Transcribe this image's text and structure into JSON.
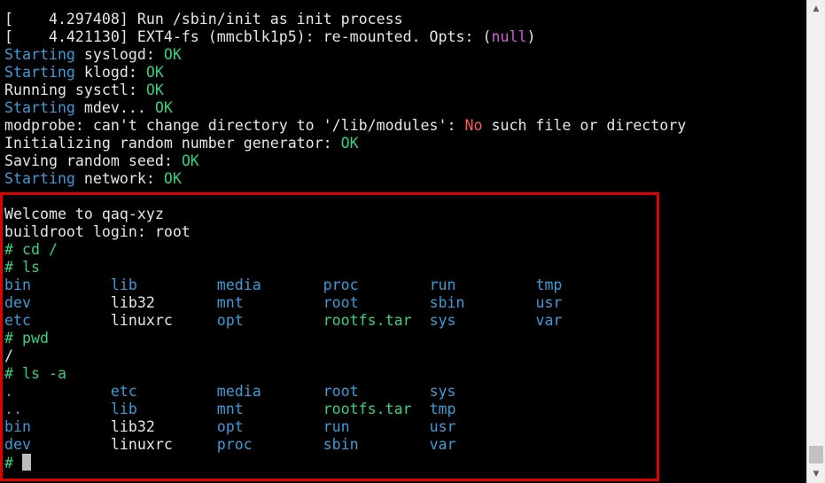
{
  "terminal": {
    "colors": {
      "white": "#e6e6e6",
      "cyan": "#3a9bd8",
      "green": "#35d07f",
      "red": "#ff5a5a",
      "magenta": "#d05ad8",
      "highlight_border": "#e00000"
    },
    "lines": [
      [
        {
          "t": "[    4.297408] Run /sbin/init as init process",
          "c": "white"
        }
      ],
      [
        {
          "t": "[    4.421130] EXT4-fs (mmcblk1p5): re-mounted. Opts: (",
          "c": "white"
        },
        {
          "t": "null",
          "c": "magenta"
        },
        {
          "t": ")",
          "c": "white"
        }
      ],
      [
        {
          "t": "Starting",
          "c": "cyan"
        },
        {
          "t": " syslogd: ",
          "c": "white"
        },
        {
          "t": "OK",
          "c": "green"
        }
      ],
      [
        {
          "t": "Starting",
          "c": "cyan"
        },
        {
          "t": " klogd: ",
          "c": "white"
        },
        {
          "t": "OK",
          "c": "green"
        }
      ],
      [
        {
          "t": "Running sysctl: ",
          "c": "white"
        },
        {
          "t": "OK",
          "c": "green"
        }
      ],
      [
        {
          "t": "Starting",
          "c": "cyan"
        },
        {
          "t": " mdev... ",
          "c": "white"
        },
        {
          "t": "OK",
          "c": "green"
        }
      ],
      [
        {
          "t": "modprobe: can't change directory to '/lib/modules': ",
          "c": "white"
        },
        {
          "t": "No",
          "c": "red"
        },
        {
          "t": " such file or directory",
          "c": "white"
        }
      ],
      [
        {
          "t": "Initializing random number generator: ",
          "c": "white"
        },
        {
          "t": "OK",
          "c": "green"
        }
      ],
      [
        {
          "t": "Saving random seed: ",
          "c": "white"
        },
        {
          "t": "OK",
          "c": "green"
        }
      ],
      [
        {
          "t": "Starting",
          "c": "cyan"
        },
        {
          "t": " network: ",
          "c": "white"
        },
        {
          "t": "OK",
          "c": "green"
        }
      ],
      [
        {
          "t": "",
          "c": "white"
        }
      ],
      [
        {
          "t": "Welcome to qaq-xyz",
          "c": "white"
        }
      ],
      [
        {
          "t": "buildroot login: root",
          "c": "white"
        }
      ],
      [
        {
          "t": "# cd /",
          "c": "green"
        }
      ],
      [
        {
          "t": "# ls",
          "c": "green"
        }
      ],
      [
        {
          "t": "bin         ",
          "c": "cyan"
        },
        {
          "t": "lib         ",
          "c": "cyan"
        },
        {
          "t": "media       ",
          "c": "cyan"
        },
        {
          "t": "proc        ",
          "c": "cyan"
        },
        {
          "t": "run         ",
          "c": "cyan"
        },
        {
          "t": "tmp",
          "c": "cyan"
        }
      ],
      [
        {
          "t": "dev         ",
          "c": "cyan"
        },
        {
          "t": "lib32       ",
          "c": "white"
        },
        {
          "t": "mnt         ",
          "c": "cyan"
        },
        {
          "t": "root        ",
          "c": "cyan"
        },
        {
          "t": "sbin        ",
          "c": "cyan"
        },
        {
          "t": "usr",
          "c": "cyan"
        }
      ],
      [
        {
          "t": "etc         ",
          "c": "cyan"
        },
        {
          "t": "linuxrc     ",
          "c": "white"
        },
        {
          "t": "opt         ",
          "c": "cyan"
        },
        {
          "t": "rootfs.tar  ",
          "c": "green"
        },
        {
          "t": "sys         ",
          "c": "cyan"
        },
        {
          "t": "var",
          "c": "cyan"
        }
      ],
      [
        {
          "t": "# pwd",
          "c": "green"
        }
      ],
      [
        {
          "t": "/",
          "c": "white"
        }
      ],
      [
        {
          "t": "# ls -a",
          "c": "green"
        }
      ],
      [
        {
          "t": ".           ",
          "c": "cyan"
        },
        {
          "t": "etc         ",
          "c": "cyan"
        },
        {
          "t": "media       ",
          "c": "cyan"
        },
        {
          "t": "root        ",
          "c": "cyan"
        },
        {
          "t": "sys",
          "c": "cyan"
        }
      ],
      [
        {
          "t": "..          ",
          "c": "cyan"
        },
        {
          "t": "lib         ",
          "c": "cyan"
        },
        {
          "t": "mnt         ",
          "c": "cyan"
        },
        {
          "t": "rootfs.tar  ",
          "c": "green"
        },
        {
          "t": "tmp",
          "c": "cyan"
        }
      ],
      [
        {
          "t": "bin         ",
          "c": "cyan"
        },
        {
          "t": "lib32       ",
          "c": "white"
        },
        {
          "t": "opt         ",
          "c": "cyan"
        },
        {
          "t": "run         ",
          "c": "cyan"
        },
        {
          "t": "usr",
          "c": "cyan"
        }
      ],
      [
        {
          "t": "dev         ",
          "c": "cyan"
        },
        {
          "t": "linuxrc     ",
          "c": "white"
        },
        {
          "t": "proc        ",
          "c": "cyan"
        },
        {
          "t": "sbin        ",
          "c": "cyan"
        },
        {
          "t": "var",
          "c": "cyan"
        }
      ],
      [
        {
          "t": "# ",
          "c": "green"
        }
      ]
    ],
    "cursor_line": 25
  },
  "scrollbar": {
    "up_icon": "triangle-up-icon",
    "down_icon": "triangle-down-icon",
    "up_glyph": "▲",
    "down_glyph": "▼"
  }
}
